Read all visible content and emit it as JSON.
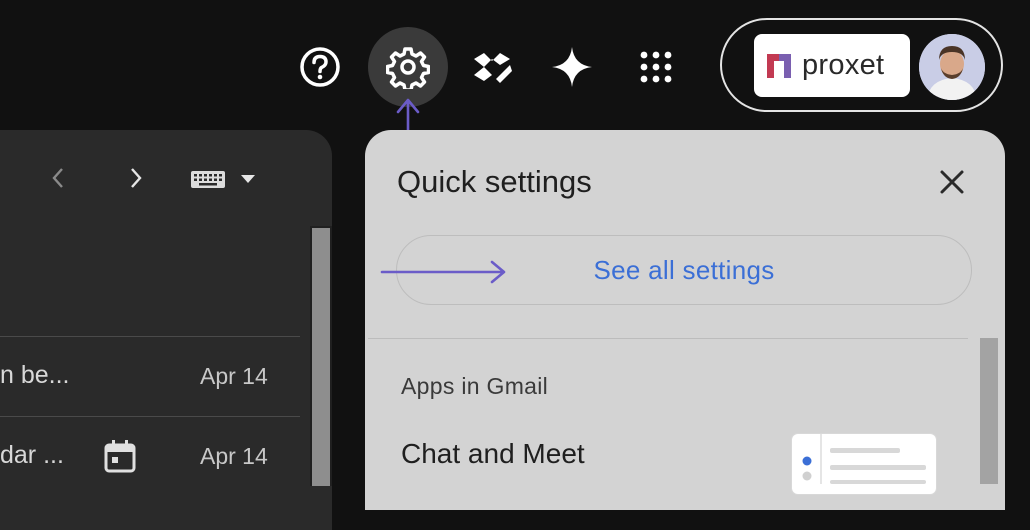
{
  "header": {
    "help_icon": "help-circle-icon",
    "settings_icon": "gear-icon",
    "tasks_icon": "tasks-icon",
    "gemini_icon": "sparkle-icon",
    "apps_icon": "apps-grid-icon",
    "org_logo_text": "proxet",
    "avatar_icon": "user-avatar"
  },
  "mail": {
    "rows": [
      {
        "snippet": "n be...",
        "date": "Apr 14"
      },
      {
        "snippet": "dar ...",
        "date": "Apr 14"
      }
    ]
  },
  "quick_settings": {
    "title": "Quick settings",
    "see_all_label": "See all settings",
    "apps_heading": "Apps in Gmail",
    "chat_meet_label": "Chat and Meet"
  },
  "colors": {
    "background": "#111111",
    "panel": "#d3d3d3",
    "link_blue": "#3b6fd6",
    "annotation": "#6b5cc8"
  }
}
